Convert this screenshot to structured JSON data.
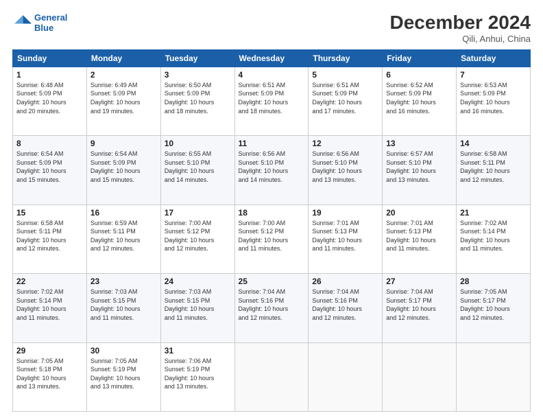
{
  "header": {
    "logo_line1": "General",
    "logo_line2": "Blue",
    "month": "December 2024",
    "location": "Qili, Anhui, China"
  },
  "weekdays": [
    "Sunday",
    "Monday",
    "Tuesday",
    "Wednesday",
    "Thursday",
    "Friday",
    "Saturday"
  ],
  "weeks": [
    [
      {
        "day": "1",
        "lines": [
          "Sunrise: 6:48 AM",
          "Sunset: 5:09 PM",
          "Daylight: 10 hours",
          "and 20 minutes."
        ]
      },
      {
        "day": "2",
        "lines": [
          "Sunrise: 6:49 AM",
          "Sunset: 5:09 PM",
          "Daylight: 10 hours",
          "and 19 minutes."
        ]
      },
      {
        "day": "3",
        "lines": [
          "Sunrise: 6:50 AM",
          "Sunset: 5:09 PM",
          "Daylight: 10 hours",
          "and 18 minutes."
        ]
      },
      {
        "day": "4",
        "lines": [
          "Sunrise: 6:51 AM",
          "Sunset: 5:09 PM",
          "Daylight: 10 hours",
          "and 18 minutes."
        ]
      },
      {
        "day": "5",
        "lines": [
          "Sunrise: 6:51 AM",
          "Sunset: 5:09 PM",
          "Daylight: 10 hours",
          "and 17 minutes."
        ]
      },
      {
        "day": "6",
        "lines": [
          "Sunrise: 6:52 AM",
          "Sunset: 5:09 PM",
          "Daylight: 10 hours",
          "and 16 minutes."
        ]
      },
      {
        "day": "7",
        "lines": [
          "Sunrise: 6:53 AM",
          "Sunset: 5:09 PM",
          "Daylight: 10 hours",
          "and 16 minutes."
        ]
      }
    ],
    [
      {
        "day": "8",
        "lines": [
          "Sunrise: 6:54 AM",
          "Sunset: 5:09 PM",
          "Daylight: 10 hours",
          "and 15 minutes."
        ]
      },
      {
        "day": "9",
        "lines": [
          "Sunrise: 6:54 AM",
          "Sunset: 5:09 PM",
          "Daylight: 10 hours",
          "and 15 minutes."
        ]
      },
      {
        "day": "10",
        "lines": [
          "Sunrise: 6:55 AM",
          "Sunset: 5:10 PM",
          "Daylight: 10 hours",
          "and 14 minutes."
        ]
      },
      {
        "day": "11",
        "lines": [
          "Sunrise: 6:56 AM",
          "Sunset: 5:10 PM",
          "Daylight: 10 hours",
          "and 14 minutes."
        ]
      },
      {
        "day": "12",
        "lines": [
          "Sunrise: 6:56 AM",
          "Sunset: 5:10 PM",
          "Daylight: 10 hours",
          "and 13 minutes."
        ]
      },
      {
        "day": "13",
        "lines": [
          "Sunrise: 6:57 AM",
          "Sunset: 5:10 PM",
          "Daylight: 10 hours",
          "and 13 minutes."
        ]
      },
      {
        "day": "14",
        "lines": [
          "Sunrise: 6:58 AM",
          "Sunset: 5:11 PM",
          "Daylight: 10 hours",
          "and 12 minutes."
        ]
      }
    ],
    [
      {
        "day": "15",
        "lines": [
          "Sunrise: 6:58 AM",
          "Sunset: 5:11 PM",
          "Daylight: 10 hours",
          "and 12 minutes."
        ]
      },
      {
        "day": "16",
        "lines": [
          "Sunrise: 6:59 AM",
          "Sunset: 5:11 PM",
          "Daylight: 10 hours",
          "and 12 minutes."
        ]
      },
      {
        "day": "17",
        "lines": [
          "Sunrise: 7:00 AM",
          "Sunset: 5:12 PM",
          "Daylight: 10 hours",
          "and 12 minutes."
        ]
      },
      {
        "day": "18",
        "lines": [
          "Sunrise: 7:00 AM",
          "Sunset: 5:12 PM",
          "Daylight: 10 hours",
          "and 11 minutes."
        ]
      },
      {
        "day": "19",
        "lines": [
          "Sunrise: 7:01 AM",
          "Sunset: 5:13 PM",
          "Daylight: 10 hours",
          "and 11 minutes."
        ]
      },
      {
        "day": "20",
        "lines": [
          "Sunrise: 7:01 AM",
          "Sunset: 5:13 PM",
          "Daylight: 10 hours",
          "and 11 minutes."
        ]
      },
      {
        "day": "21",
        "lines": [
          "Sunrise: 7:02 AM",
          "Sunset: 5:14 PM",
          "Daylight: 10 hours",
          "and 11 minutes."
        ]
      }
    ],
    [
      {
        "day": "22",
        "lines": [
          "Sunrise: 7:02 AM",
          "Sunset: 5:14 PM",
          "Daylight: 10 hours",
          "and 11 minutes."
        ]
      },
      {
        "day": "23",
        "lines": [
          "Sunrise: 7:03 AM",
          "Sunset: 5:15 PM",
          "Daylight: 10 hours",
          "and 11 minutes."
        ]
      },
      {
        "day": "24",
        "lines": [
          "Sunrise: 7:03 AM",
          "Sunset: 5:15 PM",
          "Daylight: 10 hours",
          "and 11 minutes."
        ]
      },
      {
        "day": "25",
        "lines": [
          "Sunrise: 7:04 AM",
          "Sunset: 5:16 PM",
          "Daylight: 10 hours",
          "and 12 minutes."
        ]
      },
      {
        "day": "26",
        "lines": [
          "Sunrise: 7:04 AM",
          "Sunset: 5:16 PM",
          "Daylight: 10 hours",
          "and 12 minutes."
        ]
      },
      {
        "day": "27",
        "lines": [
          "Sunrise: 7:04 AM",
          "Sunset: 5:17 PM",
          "Daylight: 10 hours",
          "and 12 minutes."
        ]
      },
      {
        "day": "28",
        "lines": [
          "Sunrise: 7:05 AM",
          "Sunset: 5:17 PM",
          "Daylight: 10 hours",
          "and 12 minutes."
        ]
      }
    ],
    [
      {
        "day": "29",
        "lines": [
          "Sunrise: 7:05 AM",
          "Sunset: 5:18 PM",
          "Daylight: 10 hours",
          "and 13 minutes."
        ]
      },
      {
        "day": "30",
        "lines": [
          "Sunrise: 7:05 AM",
          "Sunset: 5:19 PM",
          "Daylight: 10 hours",
          "and 13 minutes."
        ]
      },
      {
        "day": "31",
        "lines": [
          "Sunrise: 7:06 AM",
          "Sunset: 5:19 PM",
          "Daylight: 10 hours",
          "and 13 minutes."
        ]
      },
      null,
      null,
      null,
      null
    ]
  ]
}
